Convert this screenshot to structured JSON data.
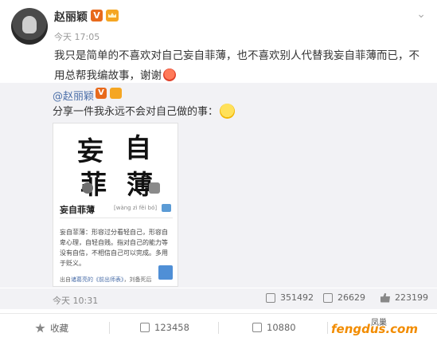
{
  "post": {
    "author": "赵丽颖",
    "verified": "V",
    "time": "今天 17:05",
    "text": "我只是简单的不喜欢对自己妄自菲薄，也不喜欢别人代替我妄自菲薄而已，不用总帮我编故事，谢谢"
  },
  "repost": {
    "author": "@赵丽颖",
    "verified": "V",
    "text": "分享一件我永远不会对自己做的事：",
    "card": {
      "big_chars": [
        "妄",
        "自",
        "菲",
        "薄"
      ],
      "title": "妄自菲薄",
      "pinyin": "[wàng zì fěi bó]",
      "description": "妄自菲薄：形容过分看轻自己，形容自卑心理，自轻自贱。指对自己的能力等没有自信，不相信自己可以完成。多用于贬义。",
      "source_prefix": "出自",
      "source_name": "诸葛亮的《前出师表》",
      "source_suffix": "，刘备死后"
    },
    "time": "今天 10:31",
    "reposts": "351492",
    "comments": "26629",
    "likes": "223199"
  },
  "actions": {
    "favorite": "收藏",
    "repost_count": "123458",
    "comment_count": "10880"
  },
  "watermark": {
    "text": "fengdus.com",
    "logo": "凤巢"
  }
}
